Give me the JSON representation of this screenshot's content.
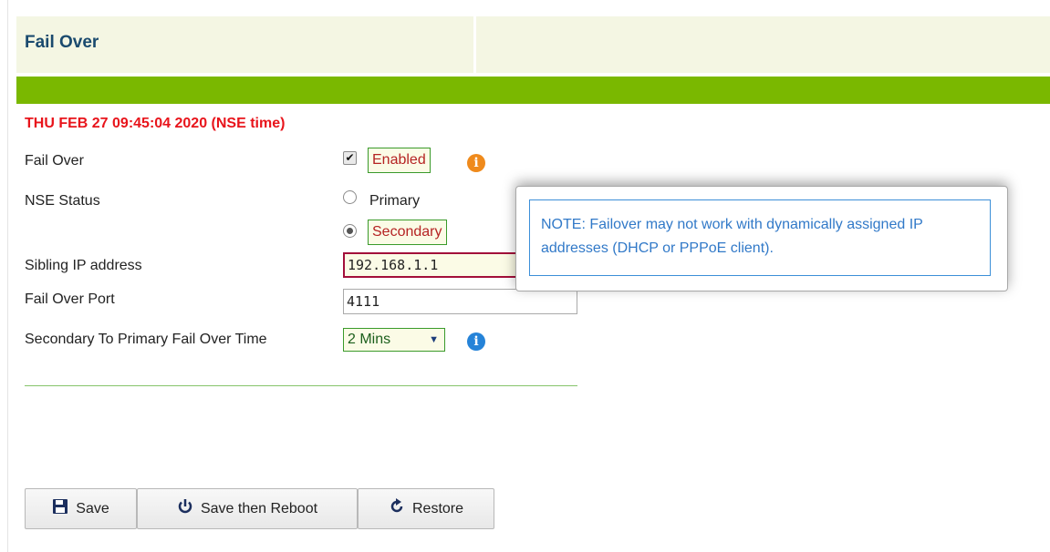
{
  "page": {
    "title": "Fail Over",
    "datetime": "THU FEB 27 09:45:04 2020   (NSE time)"
  },
  "form": {
    "failover": {
      "label": "Fail Over",
      "checked": true,
      "value_label": "Enabled"
    },
    "nse_status": {
      "label": "NSE Status",
      "options": [
        "Primary",
        "Secondary"
      ],
      "selected": "Secondary"
    },
    "sibling_ip": {
      "label": "Sibling IP address",
      "value": "192.168.1.1"
    },
    "failover_port": {
      "label": "Fail Over Port",
      "value": "4111"
    },
    "secondary_to_primary": {
      "label": "Secondary To Primary Fail Over Time",
      "selected": "2 Mins"
    }
  },
  "tooltip": {
    "text": "NOTE: Failover may not work with dynamically assigned IP addresses (DHCP or PPPoE client)."
  },
  "buttons": {
    "save": "Save",
    "save_reboot": "Save then Reboot",
    "restore": "Restore"
  },
  "icons": {
    "info": "info-icon",
    "save": "floppy-disk-icon",
    "power": "power-icon",
    "restore": "restore-arrow-icon"
  },
  "colors": {
    "green_bar": "#7ab800",
    "date_red": "#e8141b",
    "title_blue": "#1a4a6e",
    "tooltip_blue": "#3179c8"
  }
}
